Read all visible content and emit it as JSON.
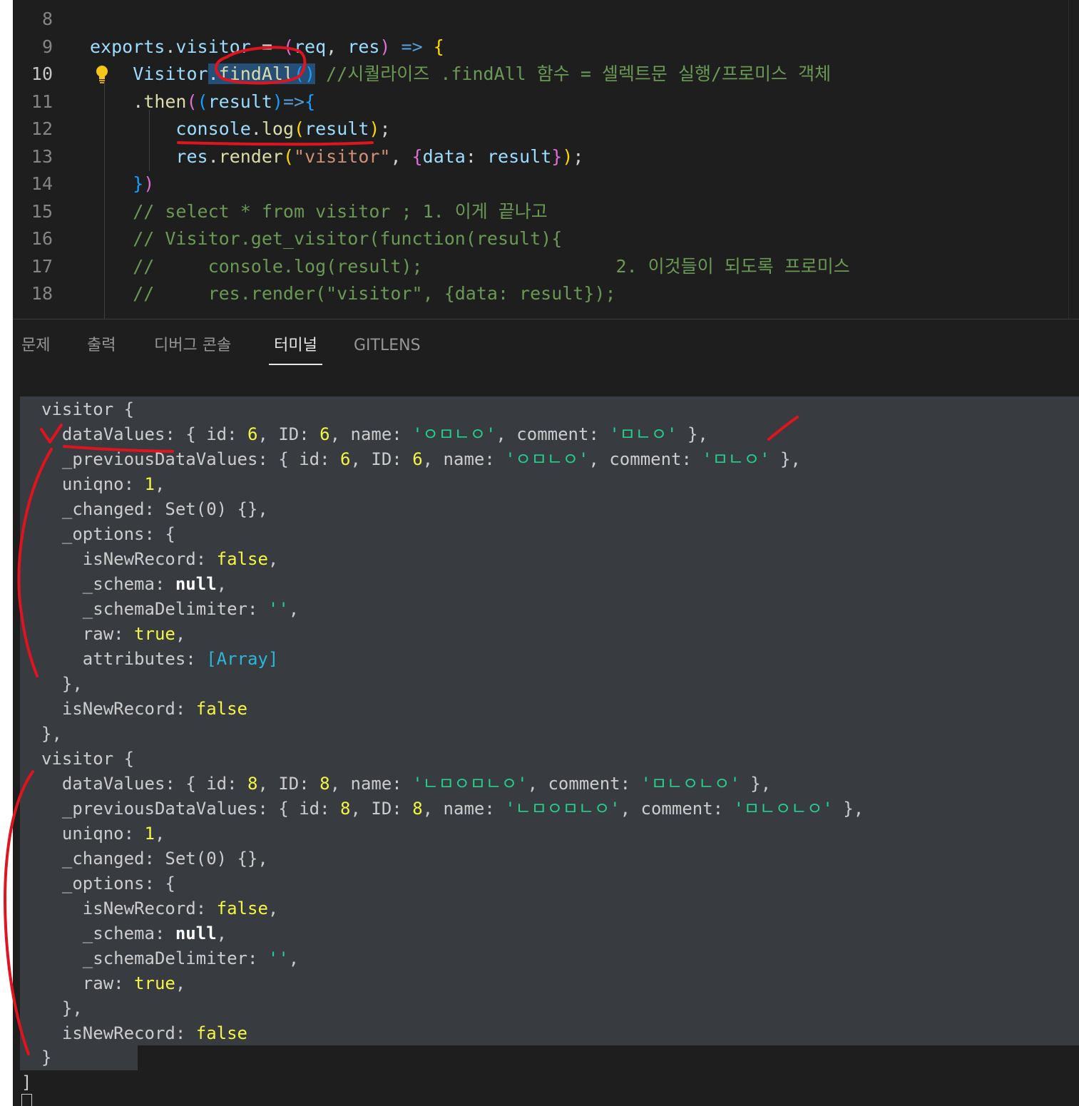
{
  "editor": {
    "lines": [
      {
        "n": "8",
        "tokens": []
      },
      {
        "n": "9",
        "tokens": [
          {
            "t": "exports",
            "c": "c-var"
          },
          {
            "t": ".",
            "c": "c-pun"
          },
          {
            "t": "visitor",
            "c": "c-var"
          },
          {
            "t": " = ",
            "c": "c-pun"
          },
          {
            "t": "(",
            "c": "c-b2"
          },
          {
            "t": "req",
            "c": "c-var"
          },
          {
            "t": ", ",
            "c": "c-pun"
          },
          {
            "t": "res",
            "c": "c-var"
          },
          {
            "t": ")",
            "c": "c-b2"
          },
          {
            "t": " ",
            "c": "c-pun"
          },
          {
            "t": "=>",
            "c": "c-kw"
          },
          {
            "t": " ",
            "c": "c-pun"
          },
          {
            "t": "{",
            "c": "c-b1"
          }
        ]
      },
      {
        "n": "10",
        "active": true,
        "tokens": [
          {
            "t": "    Visitor",
            "c": "c-var"
          },
          {
            "t": ".",
            "c": "c-pun hl"
          },
          {
            "t": "findAll",
            "c": "c-fn hl"
          },
          {
            "t": "()",
            "c": "c-b3 hl"
          },
          {
            "t": " //시퀄라이즈 .findAll 함수 = 셀렉트문 실행/프로미스 객체",
            "c": "c-com"
          }
        ]
      },
      {
        "n": "11",
        "tokens": [
          {
            "t": "    .",
            "c": "c-pun"
          },
          {
            "t": "then",
            "c": "c-fn"
          },
          {
            "t": "(",
            "c": "c-b2"
          },
          {
            "t": "(",
            "c": "c-b3"
          },
          {
            "t": "result",
            "c": "c-var"
          },
          {
            "t": ")",
            "c": "c-b3"
          },
          {
            "t": "=>",
            "c": "c-kw"
          },
          {
            "t": "{",
            "c": "c-b3"
          }
        ]
      },
      {
        "n": "12",
        "tokens": [
          {
            "t": "        console",
            "c": "c-var"
          },
          {
            "t": ".",
            "c": "c-pun"
          },
          {
            "t": "log",
            "c": "c-fn"
          },
          {
            "t": "(",
            "c": "c-b1"
          },
          {
            "t": "result",
            "c": "c-var"
          },
          {
            "t": ")",
            "c": "c-b1"
          },
          {
            "t": ";",
            "c": "c-pun"
          }
        ]
      },
      {
        "n": "13",
        "tokens": [
          {
            "t": "        res",
            "c": "c-var"
          },
          {
            "t": ".",
            "c": "c-pun"
          },
          {
            "t": "render",
            "c": "c-fn"
          },
          {
            "t": "(",
            "c": "c-b1"
          },
          {
            "t": "\"visitor\"",
            "c": "c-str"
          },
          {
            "t": ", ",
            "c": "c-pun"
          },
          {
            "t": "{",
            "c": "c-b2"
          },
          {
            "t": "data",
            "c": "c-var"
          },
          {
            "t": ": ",
            "c": "c-pun"
          },
          {
            "t": "result",
            "c": "c-var"
          },
          {
            "t": "}",
            "c": "c-b2"
          },
          {
            "t": ")",
            "c": "c-b1"
          },
          {
            "t": ";",
            "c": "c-pun"
          }
        ]
      },
      {
        "n": "14",
        "tokens": [
          {
            "t": "    }",
            "c": "c-b3"
          },
          {
            "t": ")",
            "c": "c-b2"
          }
        ]
      },
      {
        "n": "15",
        "tokens": [
          {
            "t": "    // select * from visitor ; 1. 이게 끝나고",
            "c": "c-com"
          }
        ]
      },
      {
        "n": "16",
        "tokens": [
          {
            "t": "    // Visitor.get_visitor(function(result){",
            "c": "c-com"
          }
        ]
      },
      {
        "n": "17",
        "tokens": [
          {
            "t": "    //     console.log(result);                  2. 이것들이 되도록 프로미스",
            "c": "c-com"
          }
        ]
      },
      {
        "n": "18",
        "tokens": [
          {
            "t": "    //     res.render(\"visitor\", {data: result});",
            "c": "c-com"
          }
        ]
      }
    ]
  },
  "panel": {
    "tabs": [
      "문제",
      "출력",
      "디버그 콘솔",
      "터미널",
      "GITLENS"
    ],
    "active_tab": "터미널"
  },
  "terminal": {
    "lines": [
      [
        {
          "t": "visitor {",
          "c": ""
        }
      ],
      [
        {
          "t": "  dataValues: { id: ",
          "c": ""
        },
        {
          "t": "6",
          "c": "t-num"
        },
        {
          "t": ", ID: ",
          "c": ""
        },
        {
          "t": "6",
          "c": "t-num"
        },
        {
          "t": ", name: ",
          "c": ""
        },
        {
          "t": "'ㅇㅁㄴㅇ'",
          "c": "t-str"
        },
        {
          "t": ", comment: ",
          "c": ""
        },
        {
          "t": "'ㅁㄴㅇ'",
          "c": "t-str"
        },
        {
          "t": " },",
          "c": ""
        }
      ],
      [
        {
          "t": "  _previousDataValues: { id: ",
          "c": ""
        },
        {
          "t": "6",
          "c": "t-num"
        },
        {
          "t": ", ID: ",
          "c": ""
        },
        {
          "t": "6",
          "c": "t-num"
        },
        {
          "t": ", name: ",
          "c": ""
        },
        {
          "t": "'ㅇㅁㄴㅇ'",
          "c": "t-str"
        },
        {
          "t": ", comment: ",
          "c": ""
        },
        {
          "t": "'ㅁㄴㅇ'",
          "c": "t-str"
        },
        {
          "t": " },",
          "c": ""
        }
      ],
      [
        {
          "t": "  uniqno: ",
          "c": ""
        },
        {
          "t": "1",
          "c": "t-num"
        },
        {
          "t": ",",
          "c": ""
        }
      ],
      [
        {
          "t": "  _changed: Set(0) {},",
          "c": ""
        }
      ],
      [
        {
          "t": "  _options: {",
          "c": ""
        }
      ],
      [
        {
          "t": "    isNewRecord: ",
          "c": ""
        },
        {
          "t": "false",
          "c": "t-bool"
        },
        {
          "t": ",",
          "c": ""
        }
      ],
      [
        {
          "t": "    _schema: ",
          "c": ""
        },
        {
          "t": "null",
          "c": "t-null"
        },
        {
          "t": ",",
          "c": ""
        }
      ],
      [
        {
          "t": "    _schemaDelimiter: ",
          "c": ""
        },
        {
          "t": "''",
          "c": "t-str"
        },
        {
          "t": ",",
          "c": ""
        }
      ],
      [
        {
          "t": "    raw: ",
          "c": ""
        },
        {
          "t": "true",
          "c": "t-bool"
        },
        {
          "t": ",",
          "c": ""
        }
      ],
      [
        {
          "t": "    attributes: ",
          "c": ""
        },
        {
          "t": "[Array]",
          "c": "t-arr"
        }
      ],
      [
        {
          "t": "  },",
          "c": ""
        }
      ],
      [
        {
          "t": "  isNewRecord: ",
          "c": ""
        },
        {
          "t": "false",
          "c": "t-bool"
        }
      ],
      [
        {
          "t": "},",
          "c": ""
        }
      ],
      [
        {
          "t": "visitor {",
          "c": ""
        }
      ],
      [
        {
          "t": "  dataValues: { id: ",
          "c": ""
        },
        {
          "t": "8",
          "c": "t-num"
        },
        {
          "t": ", ID: ",
          "c": ""
        },
        {
          "t": "8",
          "c": "t-num"
        },
        {
          "t": ", name: ",
          "c": ""
        },
        {
          "t": "'ㄴㅁㅇㅁㄴㅇ'",
          "c": "t-str"
        },
        {
          "t": ", comment: ",
          "c": ""
        },
        {
          "t": "'ㅁㄴㅇㄴㅇ'",
          "c": "t-str"
        },
        {
          "t": " },",
          "c": ""
        }
      ],
      [
        {
          "t": "  _previousDataValues: { id: ",
          "c": ""
        },
        {
          "t": "8",
          "c": "t-num"
        },
        {
          "t": ", ID: ",
          "c": ""
        },
        {
          "t": "8",
          "c": "t-num"
        },
        {
          "t": ", name: ",
          "c": ""
        },
        {
          "t": "'ㄴㅁㅇㅁㄴㅇ'",
          "c": "t-str"
        },
        {
          "t": ", comment: ",
          "c": ""
        },
        {
          "t": "'ㅁㄴㅇㄴㅇ'",
          "c": "t-str"
        },
        {
          "t": " },",
          "c": ""
        }
      ],
      [
        {
          "t": "  uniqno: ",
          "c": ""
        },
        {
          "t": "1",
          "c": "t-num"
        },
        {
          "t": ",",
          "c": ""
        }
      ],
      [
        {
          "t": "  _changed: Set(0) {},",
          "c": ""
        }
      ],
      [
        {
          "t": "  _options: {",
          "c": ""
        }
      ],
      [
        {
          "t": "    isNewRecord: ",
          "c": ""
        },
        {
          "t": "false",
          "c": "t-bool"
        },
        {
          "t": ",",
          "c": ""
        }
      ],
      [
        {
          "t": "    _schema: ",
          "c": ""
        },
        {
          "t": "null",
          "c": "t-null"
        },
        {
          "t": ",",
          "c": ""
        }
      ],
      [
        {
          "t": "    _schemaDelimiter: ",
          "c": ""
        },
        {
          "t": "''",
          "c": "t-str"
        },
        {
          "t": ",",
          "c": ""
        }
      ],
      [
        {
          "t": "    raw: ",
          "c": ""
        },
        {
          "t": "true",
          "c": "t-bool"
        },
        {
          "t": ",",
          "c": ""
        }
      ],
      [
        {
          "t": "  },",
          "c": ""
        }
      ],
      [
        {
          "t": "  isNewRecord: ",
          "c": ""
        },
        {
          "t": "false",
          "c": "t-bool"
        }
      ]
    ],
    "tail": [
      "}",
      "]"
    ]
  },
  "colors": {
    "annotation_ink": "#e0141e",
    "editor_bg": "#1e1e1e",
    "terminal_selection_bg": "#383b40"
  },
  "icons": {
    "lightbulb": "lightbulb-icon"
  }
}
